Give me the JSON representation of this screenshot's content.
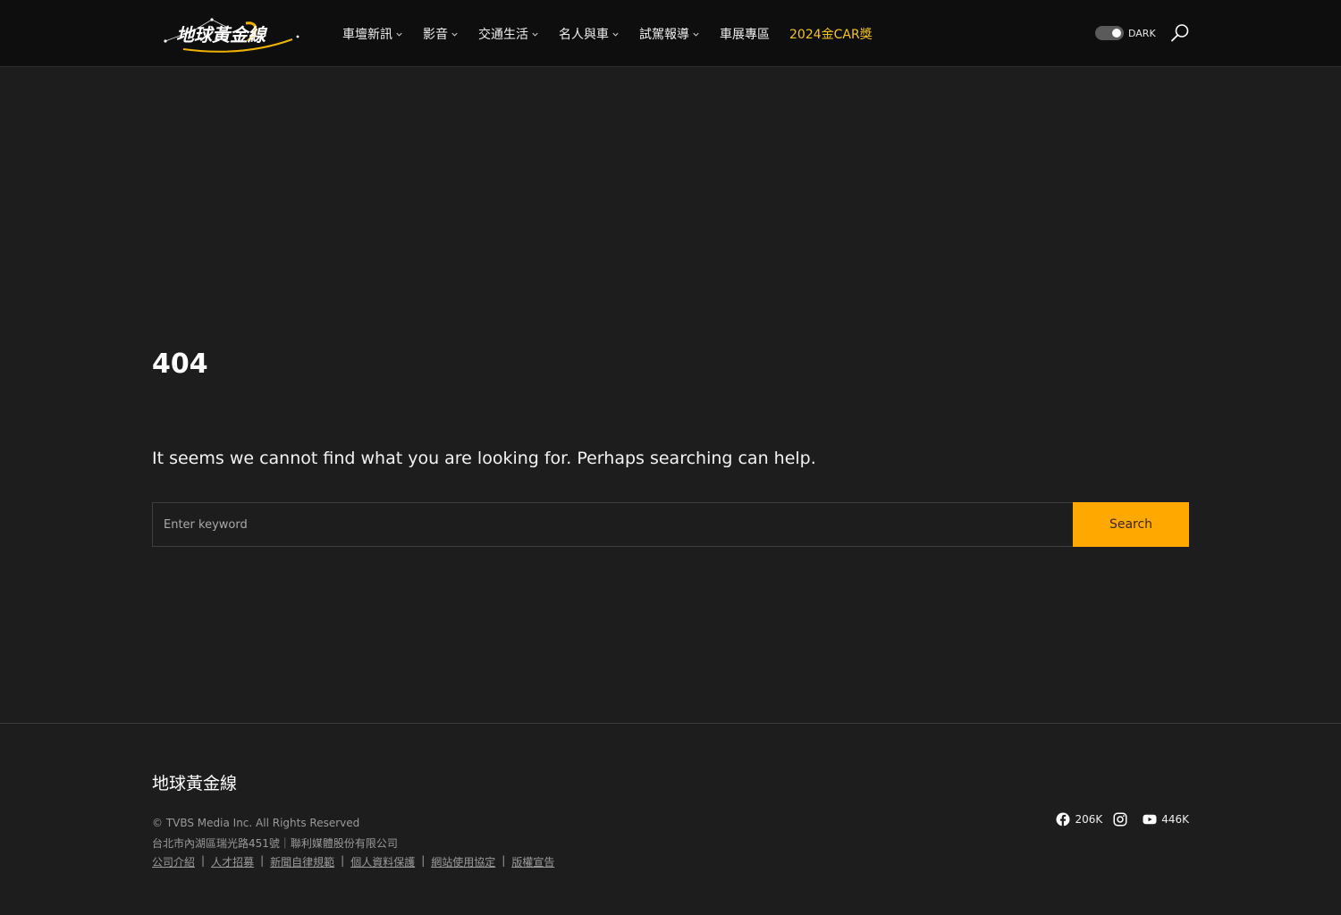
{
  "header": {
    "logo_text": "地球黃金線",
    "nav": [
      {
        "label": "車壇新訊",
        "has_dropdown": true
      },
      {
        "label": "影音",
        "has_dropdown": true
      },
      {
        "label": "交通生活",
        "has_dropdown": true
      },
      {
        "label": "名人與車",
        "has_dropdown": true
      },
      {
        "label": "試駕報導",
        "has_dropdown": true
      },
      {
        "label": "車展專區",
        "has_dropdown": false
      },
      {
        "label": "2024金CAR獎",
        "has_dropdown": false,
        "highlight": true
      }
    ],
    "theme_toggle_label": "DARK"
  },
  "main": {
    "error_code": "404",
    "message": "It seems we cannot find what you are looking for. Perhaps searching can help.",
    "search": {
      "placeholder": "Enter keyword",
      "value": "",
      "button_label": "Search"
    }
  },
  "footer": {
    "brand": "地球黃金線",
    "copyright": "© TVBS Media Inc. All Rights Reserved",
    "address": "台北市內湖區瑞光路451號｜聯利媒體股份有限公司",
    "links": [
      "公司介紹",
      "人才招募",
      "新聞自律規範",
      "個人資料保護",
      "網站使用協定",
      "版權宣告"
    ],
    "link_separator": "|",
    "social": [
      {
        "icon": "facebook-icon",
        "count": "206K"
      },
      {
        "icon": "instagram-icon",
        "count": ""
      },
      {
        "icon": "youtube-icon",
        "count": "446K"
      }
    ]
  },
  "colors": {
    "background": "#1d1d1d",
    "header_background": "#0e0e0e",
    "accent": "#ffa900",
    "highlight_nav": "#f5c518"
  }
}
